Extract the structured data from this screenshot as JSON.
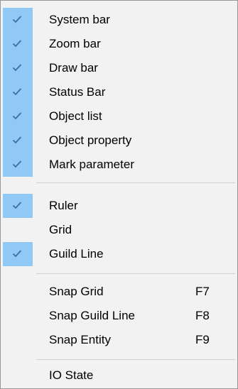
{
  "menu": {
    "items": [
      {
        "label": "System bar",
        "checked": true
      },
      {
        "label": "Zoom bar",
        "checked": true
      },
      {
        "label": "Draw bar",
        "checked": true
      },
      {
        "label": "Status Bar",
        "checked": true
      },
      {
        "label": "Object list",
        "checked": true
      },
      {
        "label": "Object property",
        "checked": true
      },
      {
        "label": "Mark parameter",
        "checked": true
      },
      {
        "label": "Ruler",
        "checked": true
      },
      {
        "label": "Grid",
        "checked": false
      },
      {
        "label": "Guild Line",
        "checked": true
      },
      {
        "label": "Snap Grid",
        "shortcut": "F7",
        "checked": false
      },
      {
        "label": "Snap Guild Line",
        "shortcut": "F8",
        "checked": false
      },
      {
        "label": "Snap Entity",
        "shortcut": "F9",
        "checked": false
      },
      {
        "label": "IO State",
        "checked": false
      }
    ]
  },
  "colors": {
    "check_highlight": "#90c8f6",
    "check_mark": "#3a6ea5",
    "background": "#f2f2f2",
    "separator": "#d0d0d0"
  },
  "icons": {
    "check": "checkmark-icon"
  }
}
